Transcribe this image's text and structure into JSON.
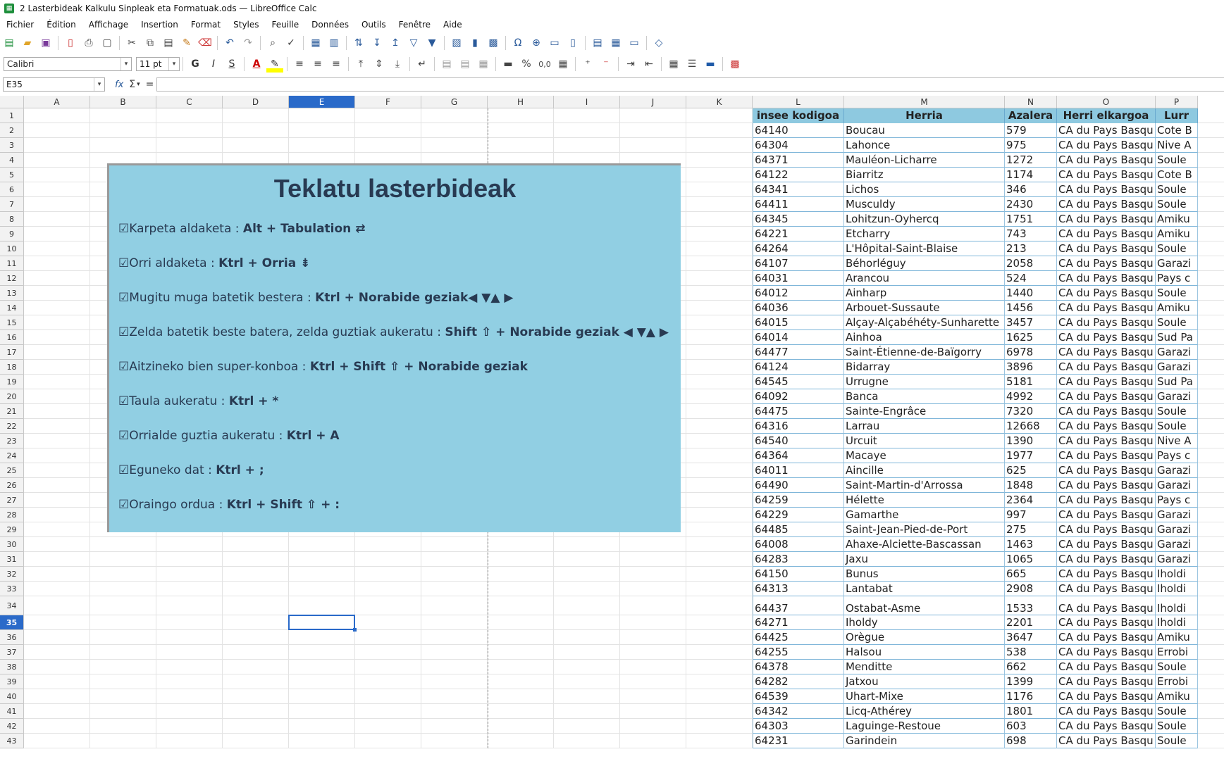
{
  "window": {
    "title": "2 Lasterbideak Kalkulu Sinpleak eta Formatuak.ods — LibreOffice Calc"
  },
  "menu": [
    "Fichier",
    "Édition",
    "Affichage",
    "Insertion",
    "Format",
    "Styles",
    "Feuille",
    "Données",
    "Outils",
    "Fenêtre",
    "Aide"
  ],
  "format": {
    "font_name": "Calibri",
    "font_size": "11 pt",
    "bold": "G",
    "italic": "I",
    "underline": "S",
    "percent": "%",
    "decimal": "0,0"
  },
  "formula": {
    "namebox": "E35",
    "fx": "fx",
    "sum": "Σ",
    "equals": "=",
    "content": ""
  },
  "columns": [
    "A",
    "B",
    "C",
    "D",
    "E",
    "F",
    "G",
    "H",
    "I",
    "J",
    "K",
    "L",
    "M",
    "N",
    "O",
    "P"
  ],
  "rows": [
    "1",
    "2",
    "3",
    "4",
    "5",
    "6",
    "7",
    "8",
    "9",
    "10",
    "11",
    "12",
    "13",
    "14",
    "15",
    "16",
    "17",
    "18",
    "19",
    "20",
    "21",
    "22",
    "23",
    "24",
    "25",
    "26",
    "27",
    "28",
    "29",
    "30",
    "31",
    "32",
    "33",
    "34",
    "35",
    "36",
    "37",
    "38",
    "39",
    "40",
    "41",
    "42",
    "43"
  ],
  "selected": {
    "column": "E",
    "row": "35"
  },
  "shape": {
    "title": "Teklatu lasterbideak",
    "lines": [
      {
        "text": "☑Karpeta aldaketa : ",
        "keys": "Alt + Tabulation ⇄"
      },
      {
        "text": "☑Orri aldaketa : ",
        "keys": "Ktrl + Orria ⇟"
      },
      {
        "text": "☑Mugitu muga batetik bestera : ",
        "keys": "Ktrl + Norabide geziak◀ ▼▲ ▶"
      },
      {
        "text": "☑Zelda batetik beste batera, zelda guztiak aukeratu : ",
        "keys": "Shift ⇧ + Norabide geziak ◀ ▼▲ ▶"
      },
      {
        "text": "☑Aitzineko bien super-konboa : ",
        "keys": "Ktrl + Shift ⇧ + Norabide geziak"
      },
      {
        "text": "☑Taula aukeratu : ",
        "keys": "Ktrl + *"
      },
      {
        "text": "☑Orrialde guztia aukeratu : ",
        "keys": "Ktrl + A"
      },
      {
        "text": "☑Eguneko dat : ",
        "keys": "Ktrl + ;"
      },
      {
        "text": "☑Oraingo ordua : ",
        "keys": "Ktrl + Shift ⇧ + :"
      }
    ]
  },
  "table": {
    "headers": [
      "insee kodigoa",
      "Herria",
      "Azalera",
      "Herri elkargoa",
      "Lurr"
    ],
    "rows": [
      [
        "64140",
        "Boucau",
        "579",
        "CA du Pays Basqu",
        "Cote B"
      ],
      [
        "64304",
        "Lahonce",
        "975",
        "CA du Pays Basqu",
        "Nive A"
      ],
      [
        "64371",
        "Mauléon-Licharre",
        "1272",
        "CA du Pays Basqu",
        "Soule"
      ],
      [
        "64122",
        "Biarritz",
        "1174",
        "CA du Pays Basqu",
        "Cote B"
      ],
      [
        "64341",
        "Lichos",
        "346",
        "CA du Pays Basqu",
        "Soule"
      ],
      [
        "64411",
        "Musculdy",
        "2430",
        "CA du Pays Basqu",
        "Soule"
      ],
      [
        "64345",
        "Lohitzun-Oyhercq",
        "1751",
        "CA du Pays Basqu",
        "Amiku"
      ],
      [
        "64221",
        "Etcharry",
        "743",
        "CA du Pays Basqu",
        "Amiku"
      ],
      [
        "64264",
        "L'Hôpital-Saint-Blaise",
        "213",
        "CA du Pays Basqu",
        "Soule"
      ],
      [
        "64107",
        "Béhorléguy",
        "2058",
        "CA du Pays Basqu",
        "Garazi"
      ],
      [
        "64031",
        "Arancou",
        "524",
        "CA du Pays Basqu",
        "Pays c"
      ],
      [
        "64012",
        "Ainharp",
        "1440",
        "CA du Pays Basqu",
        "Soule"
      ],
      [
        "64036",
        "Arbouet-Sussaute",
        "1456",
        "CA du Pays Basqu",
        "Amiku"
      ],
      [
        "64015",
        "Alçay-Alçabéhéty-Sunharette",
        "3457",
        "CA du Pays Basqu",
        "Soule"
      ],
      [
        "64014",
        "Ainhoa",
        "1625",
        "CA du Pays Basqu",
        "Sud Pa"
      ],
      [
        "64477",
        "Saint-Étienne-de-Baïgorry",
        "6978",
        "CA du Pays Basqu",
        "Garazi"
      ],
      [
        "64124",
        "Bidarray",
        "3896",
        "CA du Pays Basqu",
        "Garazi"
      ],
      [
        "64545",
        "Urrugne",
        "5181",
        "CA du Pays Basqu",
        "Sud Pa"
      ],
      [
        "64092",
        "Banca",
        "4992",
        "CA du Pays Basqu",
        "Garazi"
      ],
      [
        "64475",
        "Sainte-Engrâce",
        "7320",
        "CA du Pays Basqu",
        "Soule"
      ],
      [
        "64316",
        "Larrau",
        "12668",
        "CA du Pays Basqu",
        "Soule"
      ],
      [
        "64540",
        "Urcuit",
        "1390",
        "CA du Pays Basqu",
        "Nive A"
      ],
      [
        "64364",
        "Macaye",
        "1977",
        "CA du Pays Basqu",
        "Pays c"
      ],
      [
        "64011",
        "Aincille",
        "625",
        "CA du Pays Basqu",
        "Garazi"
      ],
      [
        "64490",
        "Saint-Martin-d'Arrossa",
        "1848",
        "CA du Pays Basqu",
        "Garazi"
      ],
      [
        "64259",
        "Hélette",
        "2364",
        "CA du Pays Basqu",
        "Pays c"
      ],
      [
        "64229",
        "Gamarthe",
        "997",
        "CA du Pays Basqu",
        "Garazi"
      ],
      [
        "64485",
        "Saint-Jean-Pied-de-Port",
        "275",
        "CA du Pays Basqu",
        "Garazi"
      ],
      [
        "64008",
        "Ahaxe-Alciette-Bascassan",
        "1463",
        "CA du Pays Basqu",
        "Garazi"
      ],
      [
        "64283",
        "Jaxu",
        "1065",
        "CA du Pays Basqu",
        "Garazi"
      ],
      [
        "64150",
        "Bunus",
        "665",
        "CA du Pays Basqu",
        "Iholdi"
      ],
      [
        "64313",
        "Lantabat",
        "2908",
        "CA du Pays Basqu",
        "Iholdi"
      ],
      [
        "64437",
        "Ostabat-Asme",
        "1533",
        "CA du Pays Basqu",
        "Iholdi"
      ],
      [
        "64271",
        "Iholdy",
        "2201",
        "CA du Pays Basqu",
        "Iholdi"
      ],
      [
        "64425",
        "Orègue",
        "3647",
        "CA du Pays Basqu",
        "Amiku"
      ],
      [
        "64255",
        "Halsou",
        "538",
        "CA du Pays Basqu",
        "Errobi"
      ],
      [
        "64378",
        "Menditte",
        "662",
        "CA du Pays Basqu",
        "Soule"
      ],
      [
        "64282",
        "Jatxou",
        "1399",
        "CA du Pays Basqu",
        "Errobi"
      ],
      [
        "64539",
        "Uhart-Mixe",
        "1176",
        "CA du Pays Basqu",
        "Amiku"
      ],
      [
        "64342",
        "Licq-Athérey",
        "1801",
        "CA du Pays Basqu",
        "Soule"
      ],
      [
        "64303",
        "Laguinge-Restoue",
        "603",
        "CA du Pays Basqu",
        "Soule"
      ],
      [
        "64231",
        "Garindein",
        "698",
        "CA du Pays Basqu",
        "Soule"
      ]
    ]
  }
}
